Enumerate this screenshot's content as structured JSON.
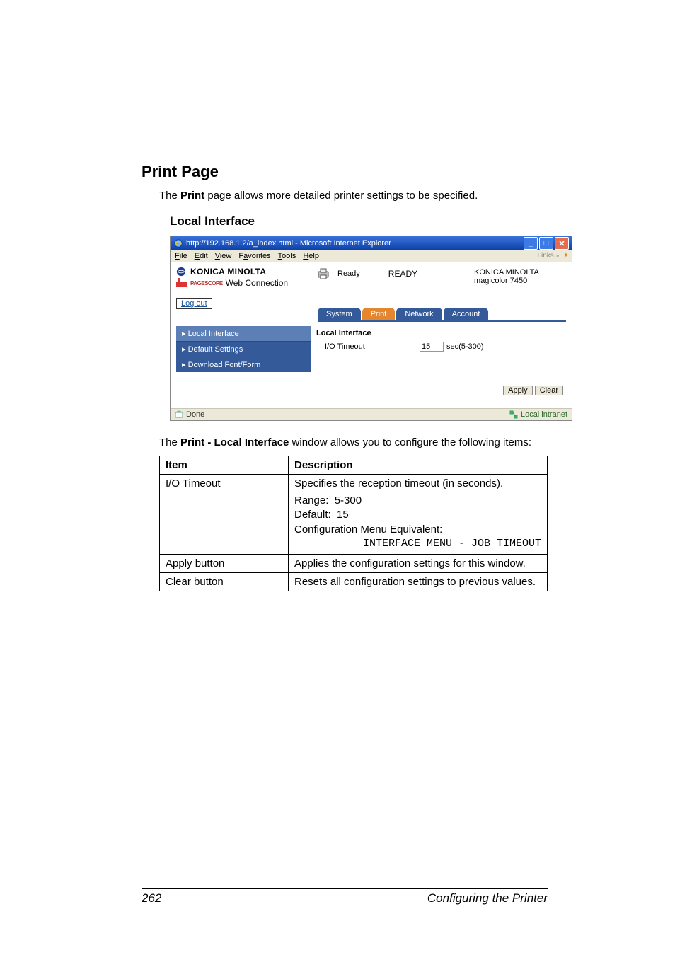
{
  "section_heading": "Print Page",
  "intro_text": "The Print page allows more detailed printer settings to be specified.",
  "sub_heading": "Local Interface",
  "browser": {
    "title": "http://192.168.1.2/a_index.html - Microsoft Internet Explorer",
    "menus": {
      "file": "File",
      "edit": "Edit",
      "view": "View",
      "favorites": "Favorites",
      "tools": "Tools",
      "help": "Help"
    },
    "links_label": "Links",
    "logout": "Log out",
    "brand": {
      "km": "KONICA MINOLTA",
      "sub_prefix": "PAGESCOPE",
      "sub": "Web Connection"
    },
    "status": {
      "ready_small": "Ready",
      "ready_big": "READY"
    },
    "device": {
      "line1": "KONICA MINOLTA",
      "line2": "magicolor 7450"
    },
    "tabs": {
      "system": "System",
      "print": "Print",
      "network": "Network",
      "account": "Account"
    },
    "sidebar": {
      "local_interface": "▸ Local Interface",
      "default_settings": "▸ Default Settings",
      "download": "▸ Download Font/Form"
    },
    "panel": {
      "title": "Local Interface",
      "io_label": "I/O Timeout",
      "io_value": "15",
      "io_unit": "sec(5-300)"
    },
    "buttons": {
      "apply": "Apply",
      "clear": "Clear"
    },
    "statusbar": {
      "done": "Done",
      "zone": "Local intranet"
    }
  },
  "caption_pre": "The ",
  "caption_bold": "Print - Local Interface",
  "caption_post": " window allows you to configure the following items:",
  "table": {
    "headers": {
      "item": "Item",
      "description": "Description"
    },
    "rows": {
      "io": {
        "item": "I/O Timeout",
        "desc_line1": "Specifies the reception timeout (in seconds).",
        "range_label": "Range:",
        "range_value": "5-300",
        "default_label": "Default:",
        "default_value": "15",
        "cfg_label": "Configuration Menu Equivalent:",
        "cfg_value": "INTERFACE MENU - JOB TIMEOUT"
      },
      "apply": {
        "item": "Apply button",
        "desc": "Applies the configuration settings for this window."
      },
      "clear": {
        "item": "Clear button",
        "desc": "Resets all configuration settings to previous values."
      }
    }
  },
  "footer": {
    "page_number": "262",
    "label": "Configuring the Printer"
  }
}
